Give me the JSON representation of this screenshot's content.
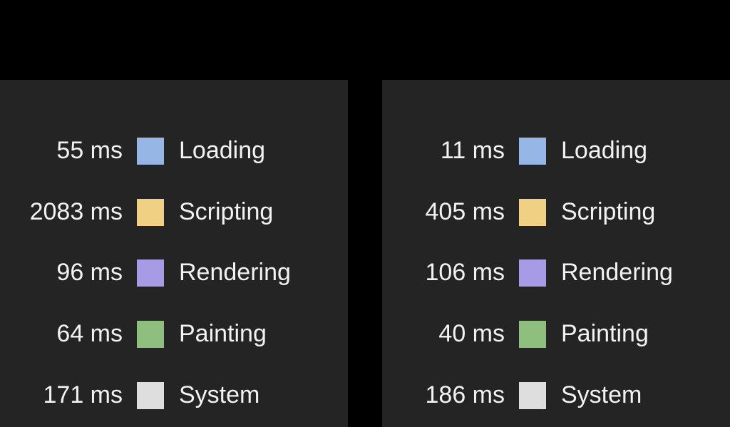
{
  "panels": [
    {
      "items": [
        {
          "value": "55 ms",
          "label": "Loading",
          "color": "#96b7e6"
        },
        {
          "value": "2083 ms",
          "label": "Scripting",
          "color": "#f0d183"
        },
        {
          "value": "96 ms",
          "label": "Rendering",
          "color": "#a89be6"
        },
        {
          "value": "64 ms",
          "label": "Painting",
          "color": "#8fbf7e"
        },
        {
          "value": "171 ms",
          "label": "System",
          "color": "#dedede"
        }
      ]
    },
    {
      "items": [
        {
          "value": "11 ms",
          "label": "Loading",
          "color": "#96b7e6"
        },
        {
          "value": "405 ms",
          "label": "Scripting",
          "color": "#f0d183"
        },
        {
          "value": "106 ms",
          "label": "Rendering",
          "color": "#a89be6"
        },
        {
          "value": "40 ms",
          "label": "Painting",
          "color": "#8fbf7e"
        },
        {
          "value": "186 ms",
          "label": "System",
          "color": "#dedede"
        }
      ]
    }
  ]
}
